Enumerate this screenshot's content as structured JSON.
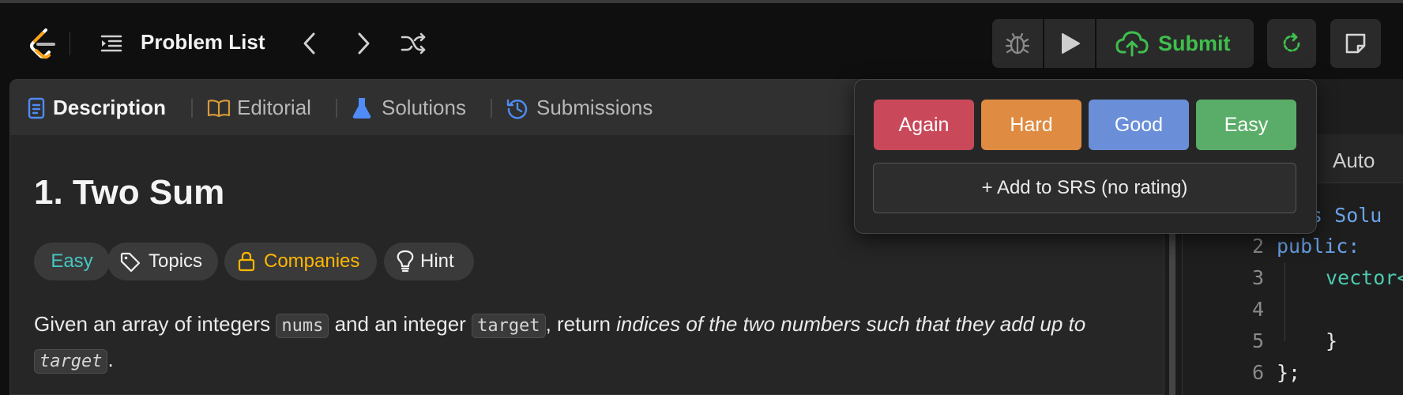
{
  "header": {
    "problem_list_label": "Problem List",
    "submit_label": "Submit"
  },
  "tabs": [
    {
      "label": "Description",
      "active": true
    },
    {
      "label": "Editorial",
      "active": false
    },
    {
      "label": "Solutions",
      "active": false
    },
    {
      "label": "Submissions",
      "active": false
    }
  ],
  "problem": {
    "title": "1. Two Sum",
    "tags": [
      {
        "label": "Easy",
        "color": "#46c6c2"
      },
      {
        "label": "Topics",
        "color": "#f2f2f2"
      },
      {
        "label": "Companies",
        "color": "#ffb700"
      },
      {
        "label": "Hint",
        "color": "#f2f2f2"
      }
    ],
    "description": {
      "p1": "Given an array of integers ",
      "code1": "nums",
      "p2": " and an integer ",
      "code2": "target",
      "p3": ", return ",
      "em1": "indices of the two numbers such that they add up to ",
      "code3": "target",
      "p4": "."
    }
  },
  "srs_popup": {
    "ratings": [
      {
        "label": "Again",
        "color": "#c9495a"
      },
      {
        "label": "Hard",
        "color": "#df8b41"
      },
      {
        "label": "Good",
        "color": "#6a8fd8"
      },
      {
        "label": "Easy",
        "color": "#5aad68"
      }
    ],
    "add_label": "+ Add to SRS (no rating)"
  },
  "editor": {
    "language_label": "Auto",
    "lines": [
      {
        "num": "",
        "text": "ss Solu"
      },
      {
        "num": "2",
        "text": "public:"
      },
      {
        "num": "3",
        "text": "vector<"
      },
      {
        "num": "4",
        "text": ""
      },
      {
        "num": "5",
        "text": "}"
      },
      {
        "num": "6",
        "text": "};"
      }
    ]
  },
  "colors": {
    "accent_green": "#3fbf4d",
    "accent_orange": "#ffa116"
  }
}
